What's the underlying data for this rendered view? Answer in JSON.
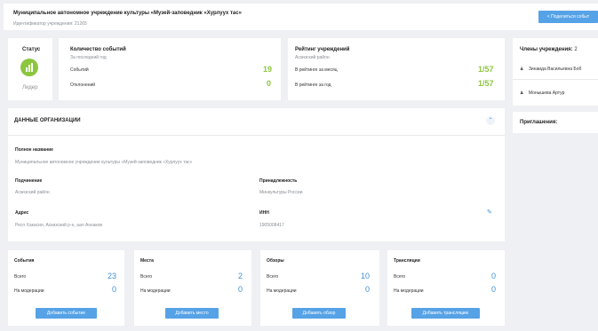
{
  "header": {
    "title": "Муниципальное автономное учреждение культуры «Музей-заповедник «Хурлуух тас»",
    "id_label": "Идентификатор учреждения: 21265",
    "share_button": "Поделиться событ"
  },
  "status_card": {
    "label": "Статус",
    "status": "Лидер",
    "color": "#8cc63f"
  },
  "events_count": {
    "title": "Количество событий",
    "subtitle": "За последний год",
    "rows": [
      {
        "label": "Событий",
        "value": "19"
      },
      {
        "label": "Отклонений",
        "value": "0"
      }
    ]
  },
  "rating": {
    "title": "Рейтинг учреждений",
    "subtitle": "Аскизский район",
    "rows": [
      {
        "label": "В рейтинге за месяц",
        "value": "1/57"
      },
      {
        "label": "В рейтинге за год",
        "value": "1/57"
      }
    ]
  },
  "members": {
    "title": "Члены учреждения:",
    "count": "2",
    "items": [
      "Зинаида Васильевна Боб",
      "Монышева Артур"
    ]
  },
  "invited": {
    "title": "Приглашения:"
  },
  "org_data": {
    "section_title": "ДАННЫЕ ОРГАНИЗАЦИИ",
    "full_name_label": "Полное название",
    "full_name": "Муниципальное автономное учреждение культуры «Музей-заповедник «Хурлуух тас»",
    "subordination_label": "Подчинение",
    "subordination": "Аскизский район",
    "affiliation_label": "Принадлежность",
    "affiliation": "Минкультуры России",
    "address_label": "Адрес",
    "address": "Респ Хакасия, Аскизский р-н, аал Анхаков",
    "inn_label": "ИНН",
    "inn": "1905008417"
  },
  "stat_cards": [
    {
      "title": "События",
      "total_label": "Всего",
      "total": "23",
      "moderation_label": "На модерации",
      "moderation": "0",
      "button": "Добавить событие"
    },
    {
      "title": "Места",
      "total_label": "Всего",
      "total": "2",
      "moderation_label": "На модерации",
      "moderation": "0",
      "button": "Добавить место"
    },
    {
      "title": "Обзоры",
      "total_label": "Всего",
      "total": "10",
      "moderation_label": "На модерации",
      "moderation": "0",
      "button": "Добавить обзор"
    },
    {
      "title": "Трансляции",
      "total_label": "Всего",
      "total": "0",
      "moderation_label": "На модерации",
      "moderation": "0",
      "button": "Добавить трансляцию"
    }
  ]
}
